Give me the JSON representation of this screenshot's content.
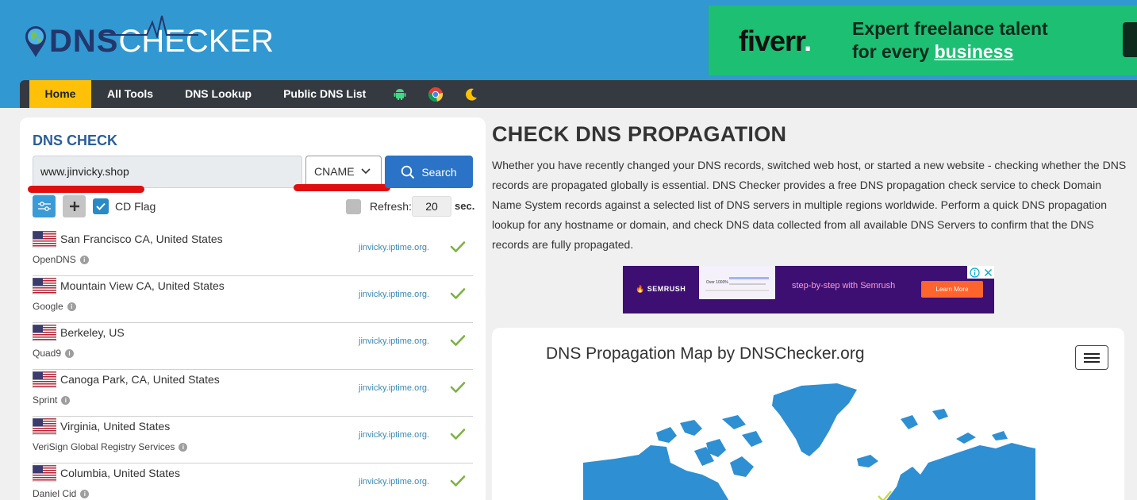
{
  "header": {
    "logo": {
      "part1": "DNS",
      "part2": "CHECKER"
    },
    "ad": {
      "brand": "fiverr",
      "brand_dot": ".",
      "line1": "Expert freelance talent",
      "line2_prefix": "for every ",
      "line2_link": "business"
    }
  },
  "nav": {
    "items": [
      {
        "label": "Home",
        "active": true
      },
      {
        "label": "All Tools"
      },
      {
        "label": "DNS Lookup"
      },
      {
        "label": "Public DNS List"
      }
    ],
    "icons": [
      "android-icon",
      "chrome-icon",
      "moon-icon"
    ]
  },
  "dns_check": {
    "title": "DNS CHECK",
    "domain_value": "www.jinvicky.shop",
    "record_type": "CNAME",
    "search_label": "Search",
    "cd_flag_label": "CD Flag",
    "cd_flag_checked": true,
    "refresh_label": "Refresh:",
    "refresh_value": "20",
    "refresh_unit": "sec.",
    "servers": [
      {
        "location": "San Francisco CA, United States",
        "provider": "OpenDNS",
        "result": "jinvicky.iptime.org.",
        "status": "ok"
      },
      {
        "location": "Mountain View CA, United States",
        "provider": "Google",
        "result": "jinvicky.iptime.org.",
        "status": "ok"
      },
      {
        "location": "Berkeley, US",
        "provider": "Quad9",
        "result": "jinvicky.iptime.org.",
        "status": "ok"
      },
      {
        "location": "Canoga Park, CA, United States",
        "provider": "Sprint",
        "result": "jinvicky.iptime.org.",
        "status": "ok"
      },
      {
        "location": "Virginia, United States",
        "provider": "VeriSign Global Registry Services",
        "result": "jinvicky.iptime.org.",
        "status": "ok"
      },
      {
        "location": "Columbia, United States",
        "provider": "Daniel Cid",
        "result": "jinvicky.iptime.org.",
        "status": "ok"
      }
    ]
  },
  "main": {
    "title": "CHECK DNS PROPAGATION",
    "description": "Whether you have recently changed your DNS records, switched web host, or started a new website - checking whether the DNS records are propagated globally is essential. DNS Checker provides a free DNS propagation check service to check Domain Name System records against a selected list of DNS servers in multiple regions worldwide. Perform a quick DNS propagation lookup for any hostname or domain, and check DNS data collected from all available DNS Servers to confirm that the DNS records are fully propagated.",
    "ad": {
      "brand": "SEMRUSH",
      "slogan": "step-by-step with Semrush",
      "cta": "Learn More",
      "stat": "Over 1000%"
    },
    "map_title": "DNS Propagation Map by DNSChecker.org"
  },
  "colors": {
    "header": "#3198d2",
    "nav": "#343a40",
    "active_tab": "#ffc107",
    "accent": "#2a73c6",
    "map": "#2e8fd2",
    "check": "#7cb342"
  }
}
